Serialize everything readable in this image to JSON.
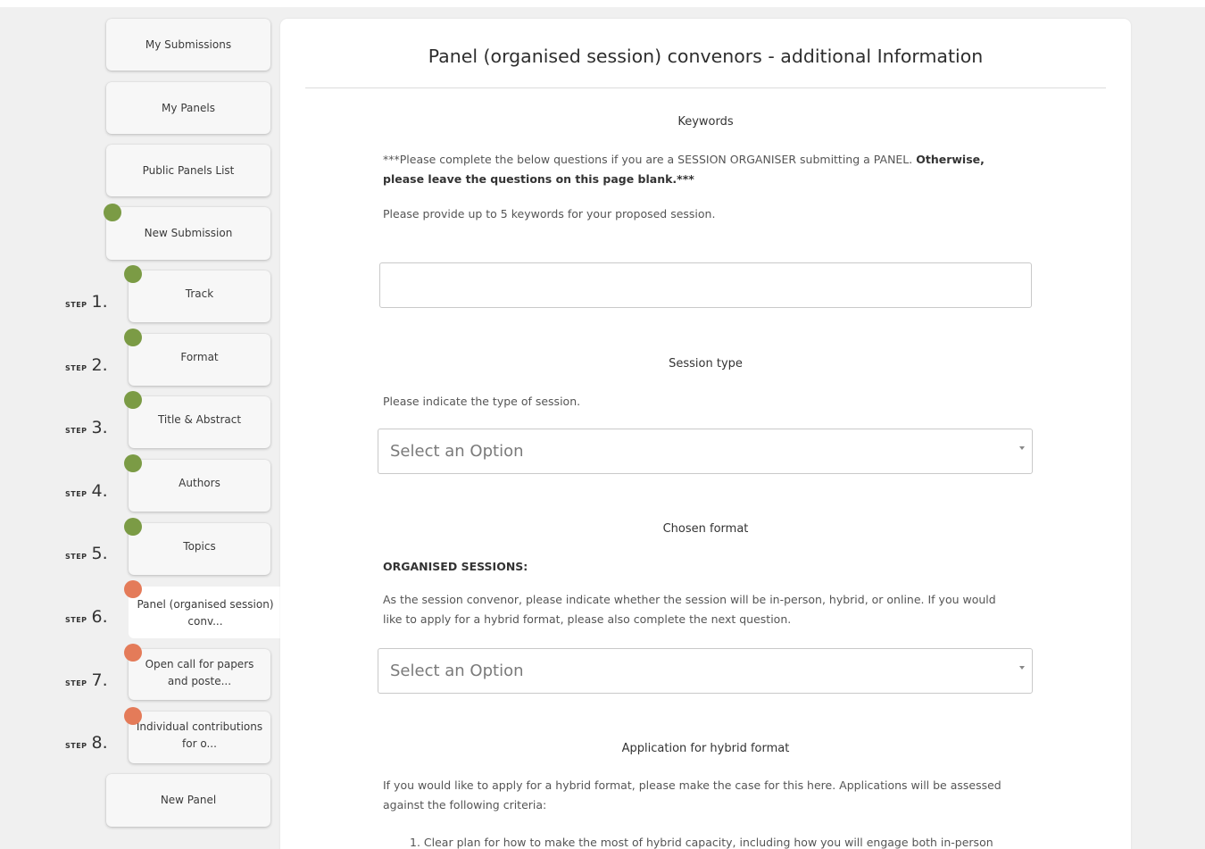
{
  "sidebar": {
    "my_submissions": "My Submissions",
    "my_panels": "My Panels",
    "public_panels_list": "Public Panels List",
    "new_submission": "New Submission",
    "new_panel": "New Panel",
    "step_word": "STEP",
    "steps": [
      {
        "num": "1.",
        "label": "Track",
        "status": "complete"
      },
      {
        "num": "2.",
        "label": "Format",
        "status": "complete"
      },
      {
        "num": "3.",
        "label": "Title & Abstract",
        "status": "complete"
      },
      {
        "num": "4.",
        "label": "Authors",
        "status": "complete"
      },
      {
        "num": "5.",
        "label": "Topics",
        "status": "complete"
      },
      {
        "num": "6.",
        "label": "Panel (organised session) conv...",
        "status": "current"
      },
      {
        "num": "7.",
        "label": "Open call for papers and poste...",
        "status": "incomplete"
      },
      {
        "num": "8.",
        "label": "Individual contributions for o...",
        "status": "incomplete"
      }
    ],
    "colors": {
      "complete": "#7b9b45",
      "incomplete": "#e47b59"
    }
  },
  "main": {
    "title": "Panel (organised session) convenors - additional Information",
    "keywords": {
      "heading": "Keywords",
      "intro_start": "***Please complete the below questions if you are a SESSION ORGANISER submitting a PANEL. ",
      "intro_bold_1": "Otherwise,",
      "intro_bold_2": "please leave the questions on this page blank.***",
      "help": "Please provide up to 5 keywords for your proposed session.",
      "value": ""
    },
    "session_type": {
      "heading": "Session type",
      "help": "Please indicate the type of session.",
      "selected": "Select an Option"
    },
    "chosen_format": {
      "heading": "Chosen format",
      "subheading": "ORGANISED SESSIONS:",
      "help_line_1": "As the session convenor, please indicate whether the session will be in-person, hybrid, or online. If you would",
      "help_line_2": "like to apply for a hybrid format, please also complete the next question.",
      "selected": "Select an Option"
    },
    "hybrid": {
      "heading": "Application for hybrid format",
      "help_line_1": "If you would like to apply for a hybrid format, please make the case for this here. Applications will be assessed",
      "help_line_2": "against the following criteria:",
      "criteria_1": "1. Clear plan for how to make the most of hybrid capacity, including how you will engage both in-person"
    }
  }
}
